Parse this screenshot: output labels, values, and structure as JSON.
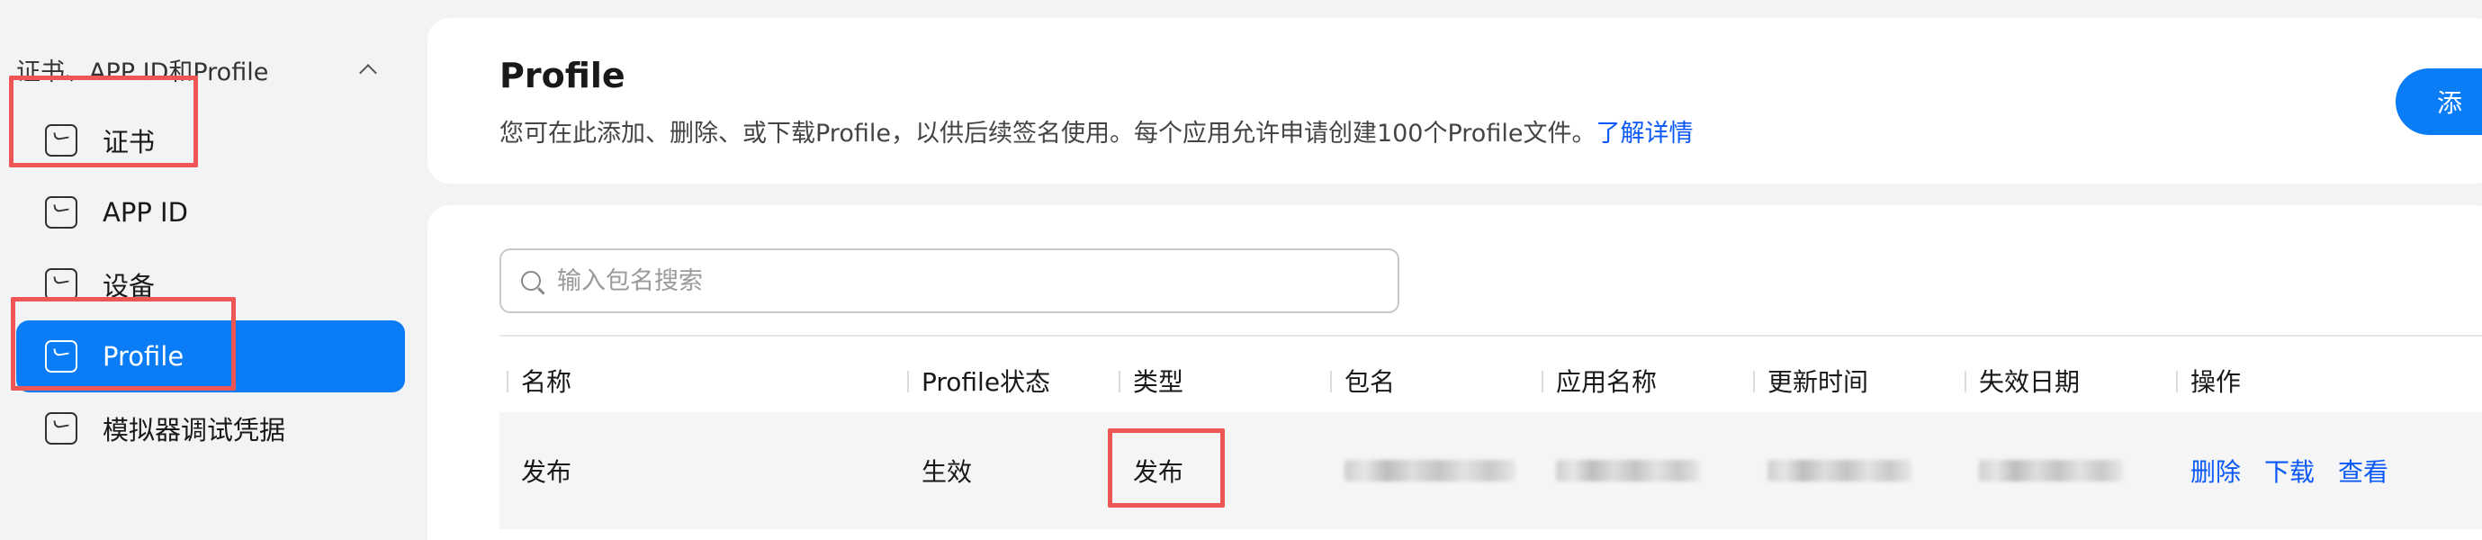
{
  "sidebar": {
    "group_label": "证书、APP ID和Profile",
    "items": [
      {
        "label": "证书",
        "icon": "certificate-icon"
      },
      {
        "label": "APP ID",
        "icon": "appid-icon"
      },
      {
        "label": "设备",
        "icon": "device-icon"
      },
      {
        "label": "Profile",
        "icon": "profile-icon",
        "active": true
      },
      {
        "label": "模拟器调试凭据",
        "icon": "emulator-credential-icon"
      }
    ]
  },
  "header": {
    "title": "Profile",
    "description": "您可在此添加、删除、或下载Profile，以供后续签名使用。每个应用允许申请创建100个Profile文件。",
    "learn_more": "了解详情",
    "add_button": "添"
  },
  "search": {
    "placeholder": "输入包名搜索"
  },
  "table": {
    "columns": [
      "名称",
      "Profile状态",
      "类型",
      "包名",
      "应用名称",
      "更新时间",
      "失效日期",
      "操作"
    ],
    "rows": [
      {
        "name": "发布",
        "status": "生效",
        "type": "发布",
        "actions": [
          "删除",
          "下载",
          "查看"
        ]
      }
    ]
  },
  "colors": {
    "accent": "#0a7cf6",
    "link": "#0a59f7",
    "annotation_red": "#ee5555",
    "background": "#f1f3f5"
  }
}
